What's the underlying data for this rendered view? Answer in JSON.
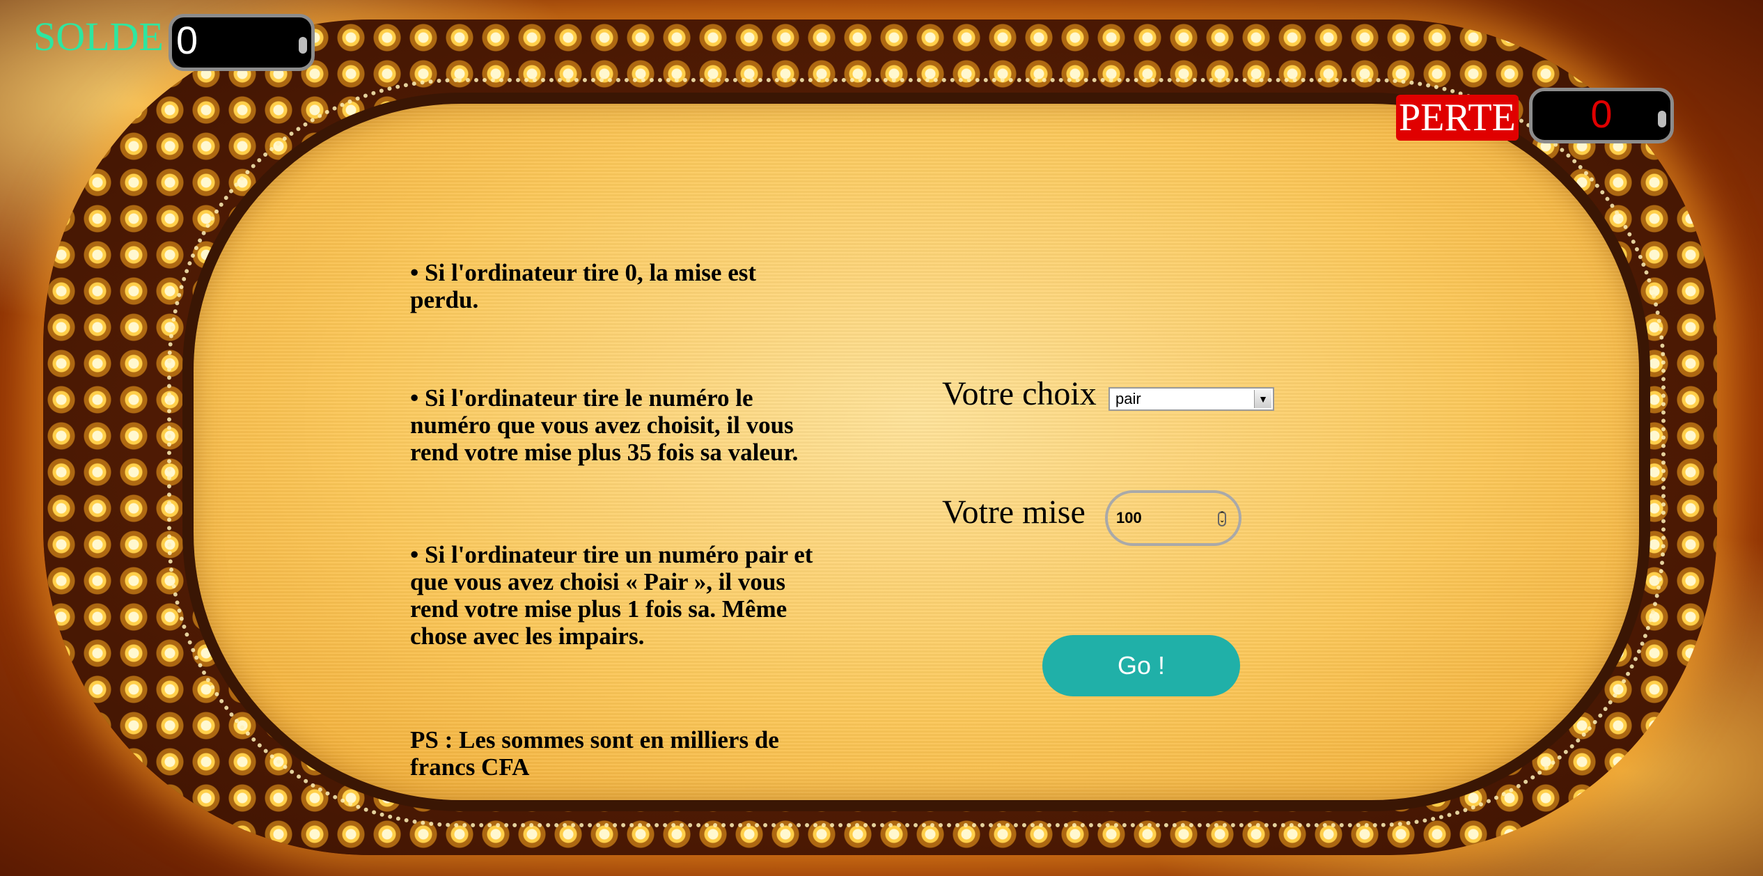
{
  "solde": {
    "label": "SOLDE",
    "value": "0"
  },
  "perte": {
    "label": "PERTE",
    "value": "0"
  },
  "rules": {
    "items": [
      "• Si l'ordinateur tire 0, la mise est perdu.",
      "• Si l'ordinateur tire le numéro le numéro que vous avez choisit, il vous rend votre mise plus 35 fois sa valeur.",
      "• Si l'ordinateur tire un numéro pair et que vous avez choisi « Pair », il vous rend votre mise plus 1 fois sa. Même chose avec les impairs."
    ],
    "ps": "PS : Les sommes sont en milliers de francs CFA"
  },
  "form": {
    "choice_label": "Votre choix",
    "choice_value": "pair",
    "mise_label": "Votre mise",
    "mise_value": "100",
    "go_label": "Go !"
  },
  "colors": {
    "solde_label": "#2ee6a0",
    "perte_badge": "#e00000",
    "go_button": "#20b0a8"
  }
}
